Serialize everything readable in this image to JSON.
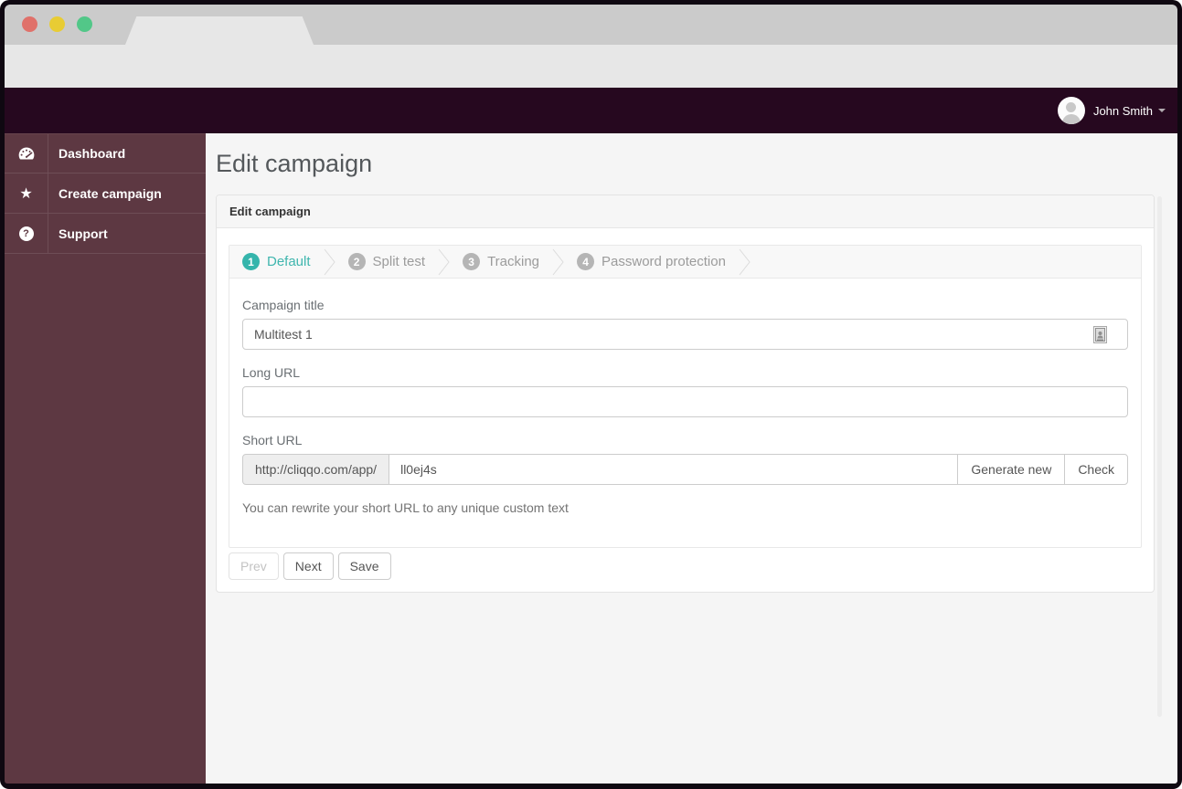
{
  "browser": {
    "traffic_lights": {
      "close": "#e0716a",
      "minimize": "#e8cc34",
      "maximize": "#52c788"
    }
  },
  "header": {
    "user_name": "John Smith"
  },
  "sidebar": {
    "items": [
      {
        "label": "Dashboard",
        "icon": "dashboard-icon"
      },
      {
        "label": "Create campaign",
        "icon": "star-icon"
      },
      {
        "label": "Support",
        "icon": "question-circle-icon"
      }
    ]
  },
  "page": {
    "title": "Edit campaign"
  },
  "panel": {
    "heading": "Edit campaign"
  },
  "wizard": {
    "steps": [
      {
        "number": "1",
        "label": "Default",
        "active": true
      },
      {
        "number": "2",
        "label": "Split test",
        "active": false
      },
      {
        "number": "3",
        "label": "Tracking",
        "active": false
      },
      {
        "number": "4",
        "label": "Password protection",
        "active": false
      }
    ]
  },
  "form": {
    "campaign_title": {
      "label": "Campaign title",
      "value": "Multitest 1"
    },
    "long_url": {
      "label": "Long URL",
      "value": ""
    },
    "short_url": {
      "label": "Short URL",
      "prefix": "http://cliqqo.com/app/",
      "value": "ll0ej4s",
      "generate_button": "Generate new",
      "check_button": "Check",
      "help": "You can rewrite your short URL to any unique custom text"
    }
  },
  "actions": {
    "prev": "Prev",
    "next": "Next",
    "save": "Save"
  },
  "colors": {
    "accent": "#35b5ac",
    "sidebar": "#5d3842",
    "header_bar": "#26081f"
  }
}
